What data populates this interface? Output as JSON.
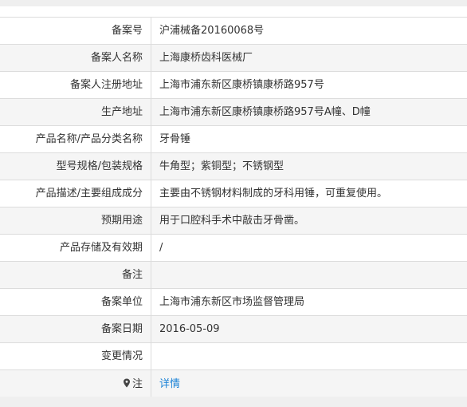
{
  "record": {
    "rows": [
      {
        "label": "备案号",
        "value": "沪浦械备20160068号"
      },
      {
        "label": "备案人名称",
        "value": "上海康桥齿科医械厂"
      },
      {
        "label": "备案人注册地址",
        "value": "上海市浦东新区康桥镇康桥路957号"
      },
      {
        "label": "生产地址",
        "value": "上海市浦东新区康桥镇康桥路957号A幢、D幢"
      },
      {
        "label": "产品名称/产品分类名称",
        "value": "牙骨锤"
      },
      {
        "label": "型号规格/包装规格",
        "value": "牛角型；紫铜型；不锈钢型"
      },
      {
        "label": "产品描述/主要组成成分",
        "value": "主要由不锈钢材料制成的牙科用锤，可重复使用。"
      },
      {
        "label": "预期用途",
        "value": "用于口腔科手术中敲击牙骨凿。"
      },
      {
        "label": "产品存储及有效期",
        "value": "/"
      },
      {
        "label": "备注",
        "value": ""
      },
      {
        "label": "备案单位",
        "value": "上海市浦东新区市场监督管理局"
      },
      {
        "label": "备案日期",
        "value": "2016-05-09"
      },
      {
        "label": "变更情况",
        "value": ""
      }
    ],
    "note": {
      "icon": "location-pin-icon",
      "label": "注",
      "link_text": "详情",
      "link_color": "#1a82d6"
    }
  }
}
